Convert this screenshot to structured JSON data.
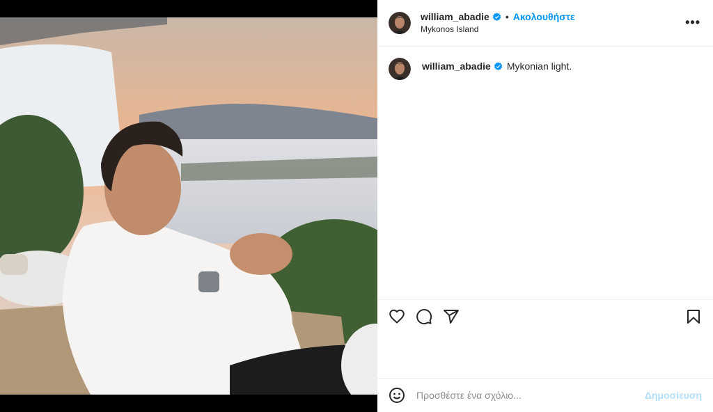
{
  "post": {
    "username": "william_abadie",
    "follow_label": "Ακολουθήστε",
    "separator": "•",
    "location": "Mykonos Island",
    "more_label": "•••"
  },
  "caption": {
    "username": "william_abadie",
    "text": "Mykonian light."
  },
  "comment": {
    "placeholder": "Προσθέστε ένα σχόλιο...",
    "post_label": "Δημοσίευση"
  },
  "icons": {
    "verified": "verified-badge-icon",
    "like": "heart-icon",
    "comment": "comment-bubble-icon",
    "share": "paper-plane-icon",
    "save": "bookmark-icon",
    "emoji": "smiley-icon"
  },
  "colors": {
    "accent": "#0095f6",
    "verified": "#0095f6",
    "post_disabled": "#b2dffc"
  }
}
